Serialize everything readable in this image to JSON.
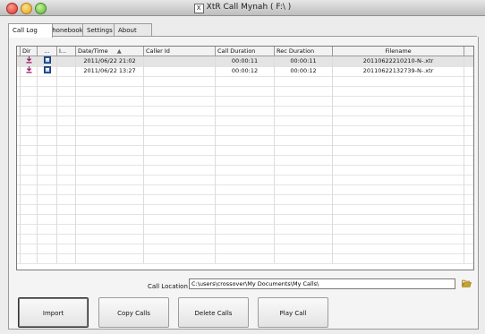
{
  "window": {
    "title": "XtR Call Mynah ( F:\\ )",
    "app_icon_glyph": "X"
  },
  "tabs": [
    {
      "label": "Call Log",
      "active": true
    },
    {
      "label": "Phonebook",
      "active": false
    },
    {
      "label": "Settings",
      "active": false
    },
    {
      "label": "About",
      "active": false
    }
  ],
  "grid": {
    "columns": {
      "dir": "Dir",
      "save": "...",
      "info": "I...",
      "datetime": "Date/Time",
      "sort_indicator": "▲",
      "caller": "Caller Id",
      "call_duration": "Call Duration",
      "rec_duration": "Rec Duration",
      "filename": "Filename"
    },
    "rows": [
      {
        "datetime": "2011/06/22 21:02",
        "caller": "",
        "call_duration": "00:00:11",
        "rec_duration": "00:00:11",
        "filename": "20110622210210-N-.xtr",
        "selected": true
      },
      {
        "datetime": "2011/06/22 13:27",
        "caller": "",
        "call_duration": "00:00:12",
        "rec_duration": "00:00:12",
        "filename": "20110622132739-N-.xtr",
        "selected": false
      }
    ],
    "dir_icon": "incoming-call-icon",
    "save_icon": "floppy-disk-icon"
  },
  "call_location": {
    "label": "Call Location",
    "value": "C:\\users\\crossover\\My Documents\\My Calls\\",
    "browse_icon": "folder-icon"
  },
  "buttons": {
    "import": "Import",
    "copy": "Copy Calls",
    "delete": "Delete Calls",
    "play": "Play Call"
  },
  "colors": {
    "dir_icon": "#9b1b6a",
    "save_icon": "#2f5ea8",
    "folder_icon": "#c9a227"
  }
}
